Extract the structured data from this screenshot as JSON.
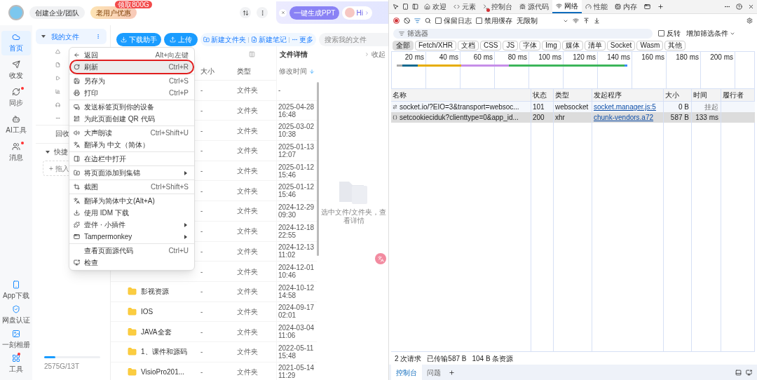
{
  "app": {
    "header": {
      "team_button": "创建企业/团队",
      "offer_button": "老用户优惠",
      "offer_badge": "领取800G",
      "ppt_button": "一键生成PPT",
      "greeting": "Hi"
    },
    "rail": {
      "top": [
        {
          "label": "首页",
          "selected": true,
          "dot": false
        },
        {
          "label": "收发",
          "selected": false,
          "dot": false
        },
        {
          "label": "同步",
          "selected": false,
          "dot": true
        },
        {
          "label": "AI工具",
          "selected": false,
          "dot": false
        },
        {
          "label": "消息",
          "selected": false,
          "dot": true
        }
      ],
      "bottom": [
        {
          "label": "App下载",
          "dot": false
        },
        {
          "label": "网盘认证",
          "dot": false
        },
        {
          "label": "一刻相册",
          "dot": false
        },
        {
          "label": "工具",
          "dot": true
        }
      ]
    },
    "side": {
      "my_files": "我的文件",
      "recycle": "回收",
      "quick": "快捷",
      "drop_hint": "+ 拖入",
      "storage": {
        "text": "2575G/13T",
        "level": 0.2
      }
    },
    "toolbar": {
      "download": "下载助手",
      "upload": "上传",
      "new_folder": "新建文件夹",
      "new_note": "新建笔记",
      "more": "更多",
      "search_placeholder": "搜索我的文件"
    },
    "table": {
      "columns": [
        "大小",
        "类型",
        "修改时间"
      ],
      "rows": [
        {
          "size": "-",
          "type": "文件夹",
          "date": "-",
          "time": ""
        },
        {
          "size": "-",
          "type": "文件夹",
          "date": "2025-04-28",
          "time": "16:48"
        },
        {
          "size": "-",
          "type": "文件夹",
          "date": "2025-03-02",
          "time": "10:38"
        },
        {
          "size": "-",
          "type": "文件夹",
          "date": "2025-01-13",
          "time": "12:07"
        },
        {
          "size": "-",
          "type": "文件夹",
          "date": "2025-01-12",
          "time": "15:46"
        },
        {
          "size": "-",
          "type": "文件夹",
          "date": "2025-01-12",
          "time": "15:46"
        },
        {
          "size": "-",
          "type": "文件夹",
          "date": "2024-12-29",
          "time": "09:30"
        },
        {
          "size": "-",
          "type": "文件夹",
          "date": "2024-12-18",
          "time": "22:55"
        },
        {
          "size": "-",
          "type": "文件夹",
          "date": "2024-12-13",
          "time": "11:02"
        },
        {
          "size": "-",
          "type": "文件夹",
          "date": "2024-12-01",
          "time": "10:46"
        },
        {
          "name": "影视资源",
          "size": "-",
          "type": "文件夹",
          "date": "2024-10-12",
          "time": "14:58"
        },
        {
          "name": "IOS",
          "size": "-",
          "type": "文件夹",
          "date": "2024-09-17",
          "time": "02:01"
        },
        {
          "name": "JAVA全套",
          "size": "-",
          "type": "文件夹",
          "date": "2024-03-04",
          "time": "11:06"
        },
        {
          "name": "1、课件和源码",
          "size": "-",
          "type": "文件夹",
          "date": "2022-05-11",
          "time": "15:48"
        },
        {
          "name": "VisioPro201...",
          "size": "-",
          "type": "文件夹",
          "date": "2021-05-14",
          "time": "11:29"
        }
      ]
    },
    "detail": {
      "title": "文件详情",
      "collapse": "收起",
      "hint": "选中文件/文件夹，查看详情"
    },
    "context_menu": [
      [
        {
          "label": "返回",
          "shortcut": "Alt+向左键",
          "highlighted": false,
          "submenu": false
        },
        {
          "label": "刷新",
          "shortcut": "Ctrl+R",
          "highlighted": true,
          "submenu": false
        }
      ],
      [
        {
          "label": "另存为",
          "shortcut": "Ctrl+S",
          "highlighted": false,
          "submenu": false
        },
        {
          "label": "打印",
          "shortcut": "Ctrl+P",
          "highlighted": false,
          "submenu": false
        }
      ],
      [
        {
          "label": "发送标签页到你的设备",
          "highlighted": false,
          "submenu": false
        },
        {
          "label": "为此页面创建 QR 代码",
          "highlighted": false,
          "submenu": false
        }
      ],
      [
        {
          "label": "大声朗读",
          "shortcut": "Ctrl+Shift+U",
          "highlighted": false,
          "submenu": false
        },
        {
          "label": "翻译为 中文（简体）",
          "highlighted": false,
          "submenu": false
        }
      ],
      [
        {
          "label": "在边栏中打开",
          "highlighted": false,
          "submenu": false
        }
      ],
      [
        {
          "label": "将页面添加到集锦",
          "highlighted": false,
          "submenu": true
        }
      ],
      [
        {
          "label": "截图",
          "shortcut": "Ctrl+Shift+S",
          "highlighted": false,
          "submenu": false
        }
      ],
      [
        {
          "label": "翻译为简体中文(Alt+A)",
          "highlighted": false,
          "submenu": false
        },
        {
          "label": "使用 IDM 下载",
          "highlighted": false,
          "submenu": false
        },
        {
          "label": "壹伴 · 小插件",
          "highlighted": false,
          "submenu": true
        },
        {
          "label": "Tampermonkey",
          "highlighted": false,
          "submenu": true
        }
      ],
      [
        {
          "label": "查看页面源代码",
          "shortcut": "Ctrl+U",
          "highlighted": false,
          "submenu": false
        },
        {
          "label": "检查",
          "highlighted": false,
          "submenu": false
        }
      ]
    ]
  },
  "devtools": {
    "tabs": [
      {
        "label": "欢迎",
        "selected": false,
        "error_badge": false
      },
      {
        "label": "元素",
        "selected": false,
        "error_badge": false
      },
      {
        "label": "控制台",
        "selected": false,
        "error_badge": true
      },
      {
        "label": "源代码",
        "selected": false,
        "error_badge": false
      },
      {
        "label": "网络",
        "selected": true,
        "error_badge": false
      },
      {
        "label": "性能",
        "selected": false,
        "error_badge": false
      },
      {
        "label": "内存",
        "selected": false,
        "error_badge": false
      }
    ],
    "toolbar": {
      "preserve_log": {
        "label": "保留日志",
        "checked": false
      },
      "disable_cache": {
        "label": "禁用缓存",
        "checked": false
      },
      "throttle": "无限制"
    },
    "filter": {
      "placeholder": "筛选器",
      "invert": {
        "label": "反转",
        "checked": false
      },
      "more_filters": "增加筛选条件"
    },
    "type_chips": [
      {
        "label": "全部",
        "selected": true
      },
      {
        "label": "Fetch/XHR",
        "selected": false
      },
      {
        "label": "文档",
        "selected": false
      },
      {
        "label": "CSS",
        "selected": false
      },
      {
        "label": "JS",
        "selected": false
      },
      {
        "label": "字体",
        "selected": false
      },
      {
        "label": "Img",
        "selected": false
      },
      {
        "label": "媒体",
        "selected": false
      },
      {
        "label": "清单",
        "selected": false
      },
      {
        "label": "Socket",
        "selected": false
      },
      {
        "label": "Wasm",
        "selected": false
      },
      {
        "label": "其他",
        "selected": false
      }
    ],
    "timeline_ticks": [
      "20 ms",
      "40 ms",
      "60 ms",
      "80 ms",
      "100 ms",
      "120 ms",
      "140 ms",
      "160 ms",
      "180 ms",
      "200 ms"
    ],
    "columns": [
      "名称",
      "状态",
      "类型",
      "发起程序",
      "大小",
      "时间",
      "履行者"
    ],
    "requests": [
      {
        "kind": "socket",
        "name": "socket.io/?EIO=3&transport=websoc...",
        "status": "101",
        "type": "websocket",
        "initiator": "socket.manager.js:5",
        "size": "0 B",
        "time": "挂起",
        "pending": true,
        "selected": false
      },
      {
        "kind": "xhr",
        "name": "setcookieciduk?clienttype=0&app_id...",
        "status": "200",
        "type": "xhr",
        "initiator": "chunk-vendors.a72",
        "size": "587 B",
        "time": "133 ms",
        "pending": false,
        "selected": true
      }
    ],
    "summary": [
      "2 次请求",
      "已传输587 B",
      "104 B 条资源"
    ],
    "drawer_tabs": [
      {
        "label": "控制台",
        "selected": true
      },
      {
        "label": "问题",
        "selected": false
      }
    ]
  }
}
